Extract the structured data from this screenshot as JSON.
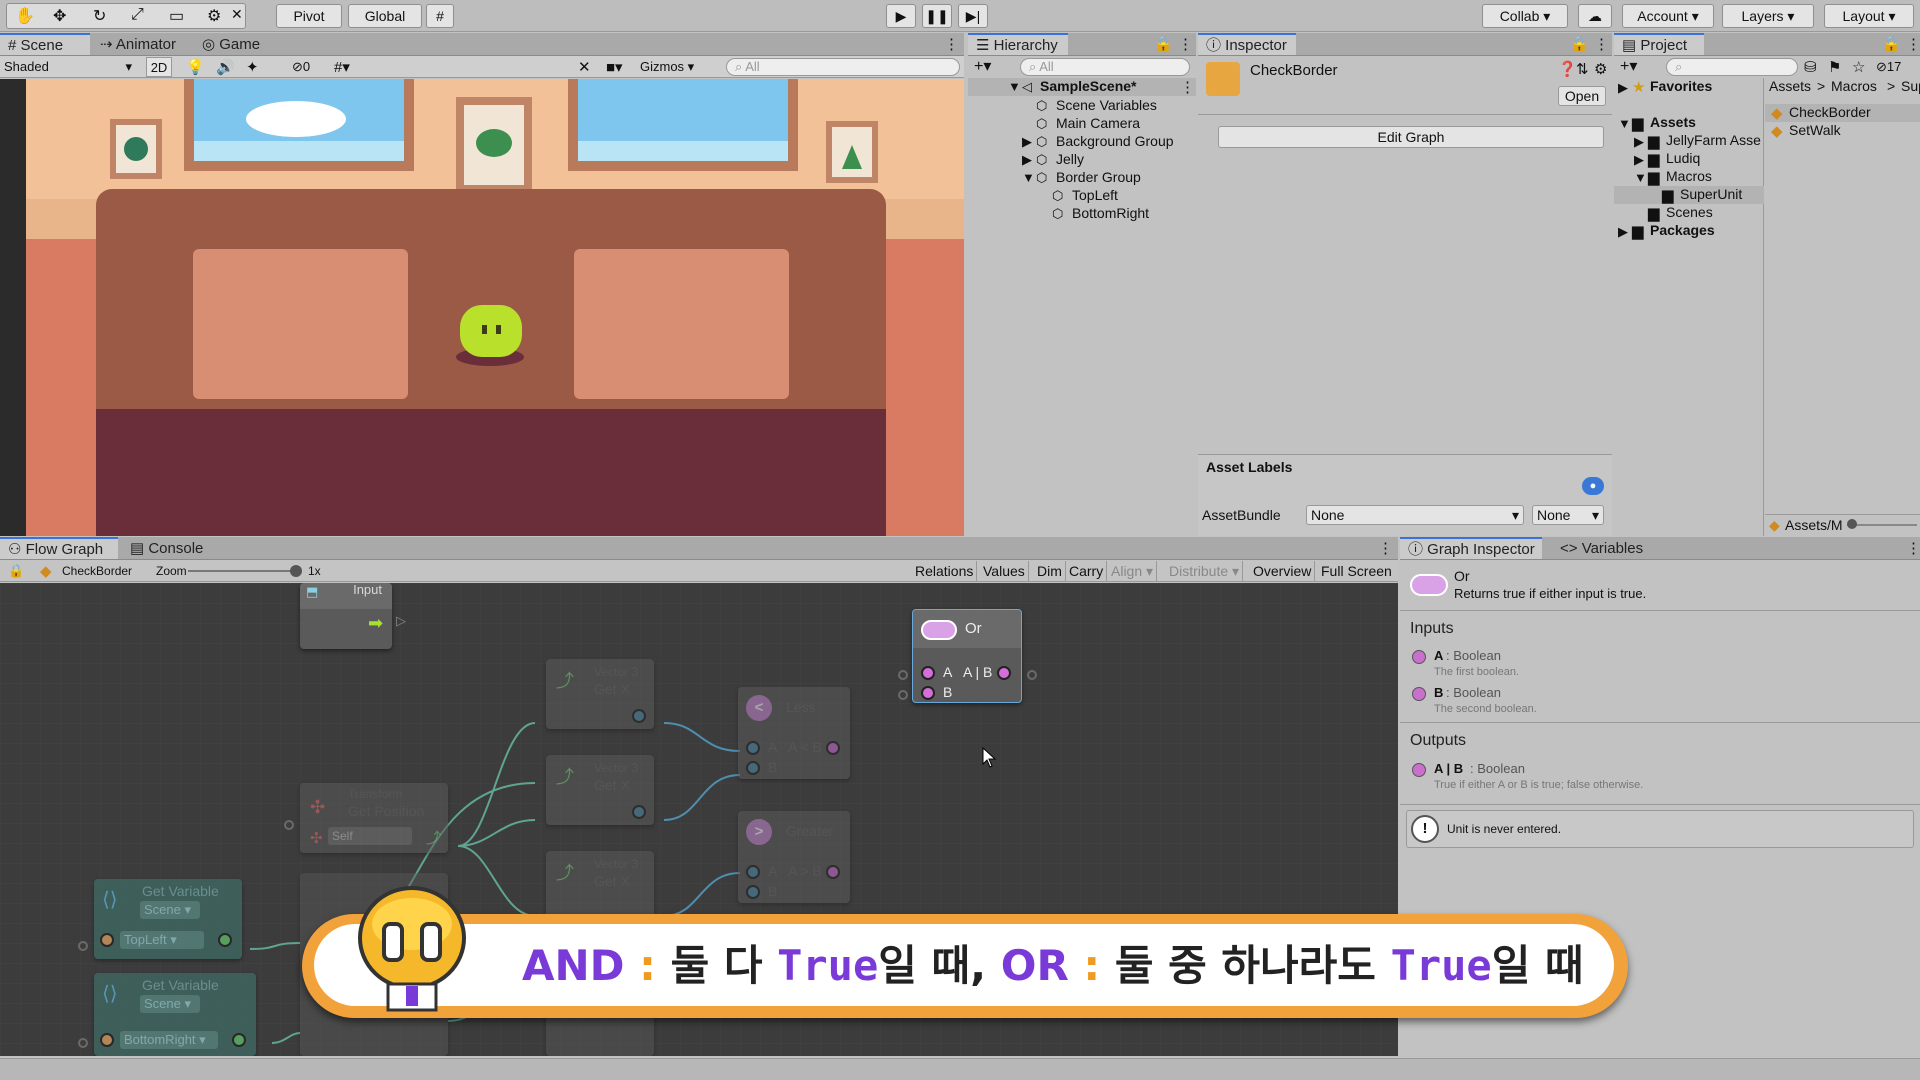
{
  "toolbar": {
    "pivot": "Pivot",
    "global": "Global",
    "collab": "Collab",
    "account": "Account",
    "layers": "Layers",
    "layout": "Layout"
  },
  "scene": {
    "tabs": [
      "Scene",
      "Animator",
      "Game"
    ],
    "shading": "Shaded",
    "mode_2d": "2D",
    "hidden_count": "0",
    "gizmos": "Gizmos",
    "search_placeholder": "All"
  },
  "hierarchy": {
    "title": "Hierarchy",
    "search_placeholder": "All",
    "items": [
      "SampleScene*",
      "Scene Variables",
      "Main Camera",
      "Background Group",
      "Jelly",
      "Border Group",
      "TopLeft",
      "BottomRight"
    ]
  },
  "inspector": {
    "title": "Inspector",
    "object_name": "CheckBorder",
    "open_label": "Open",
    "edit_graph_label": "Edit Graph",
    "asset_labels": "Asset Labels",
    "assetbundle_label": "AssetBundle",
    "assetbundle_value": "None",
    "variant_value": "None"
  },
  "project": {
    "title": "Project",
    "badge": "17",
    "favorites": "Favorites",
    "tree": [
      "Assets",
      "JellyFarm Asse",
      "Ludiq",
      "Macros",
      "SuperUnit",
      "Scenes",
      "Packages"
    ],
    "breadcrumb": [
      "Assets",
      "Macros",
      "Sup"
    ],
    "files": [
      "CheckBorder",
      "SetWalk"
    ],
    "footer_path": "Assets/M"
  },
  "flowgraph": {
    "tabs": [
      "Flow Graph",
      "Console"
    ],
    "graph_name": "CheckBorder",
    "zoom_label": "Zoom",
    "zoom_value": "1x",
    "toolbar": [
      "Relations",
      "Values",
      "Dim",
      "Carry",
      "Align",
      "Distribute",
      "Overview",
      "Full Screen"
    ],
    "nodes": {
      "input": "Input",
      "or_title": "Or",
      "or_a": "A",
      "or_b": "B",
      "or_out": "A | B",
      "vec_title": "Vector 3",
      "getx": "Get X",
      "less": "Less",
      "greater": "Greater",
      "less_out": "A < B",
      "greater_out": "A > B",
      "port_a": "A",
      "port_b": "B",
      "transform": "Transform",
      "get_position": "Get Position",
      "self": "Self",
      "getvar": "Get Variable",
      "scene": "Scene",
      "topleft": "TopLeft",
      "bottomright": "BottomRight"
    }
  },
  "graph_inspector": {
    "tabs": [
      "Graph Inspector",
      "Variables"
    ],
    "unit_name": "Or",
    "unit_desc": "Returns true if either input is true.",
    "inputs_title": "Inputs",
    "input_a": "A",
    "input_a_type": ": Boolean",
    "input_a_desc": "The first boolean.",
    "input_b": "B",
    "input_b_type": ": Boolean",
    "input_b_desc": "The second boolean.",
    "outputs_title": "Outputs",
    "output": "A | B",
    "output_type": ": Boolean",
    "output_desc": "True if either A or B is true; false otherwise.",
    "warning": "Unit is never entered."
  },
  "caption": {
    "and": "AND",
    "colon1": " : ",
    "part1": "둘 다 ",
    "true1": "True",
    "part2": "일 때, ",
    "or": "OR",
    "colon2": " : ",
    "part3": "둘 중 하나라도 ",
    "true2": "True",
    "part4": "일 때"
  }
}
